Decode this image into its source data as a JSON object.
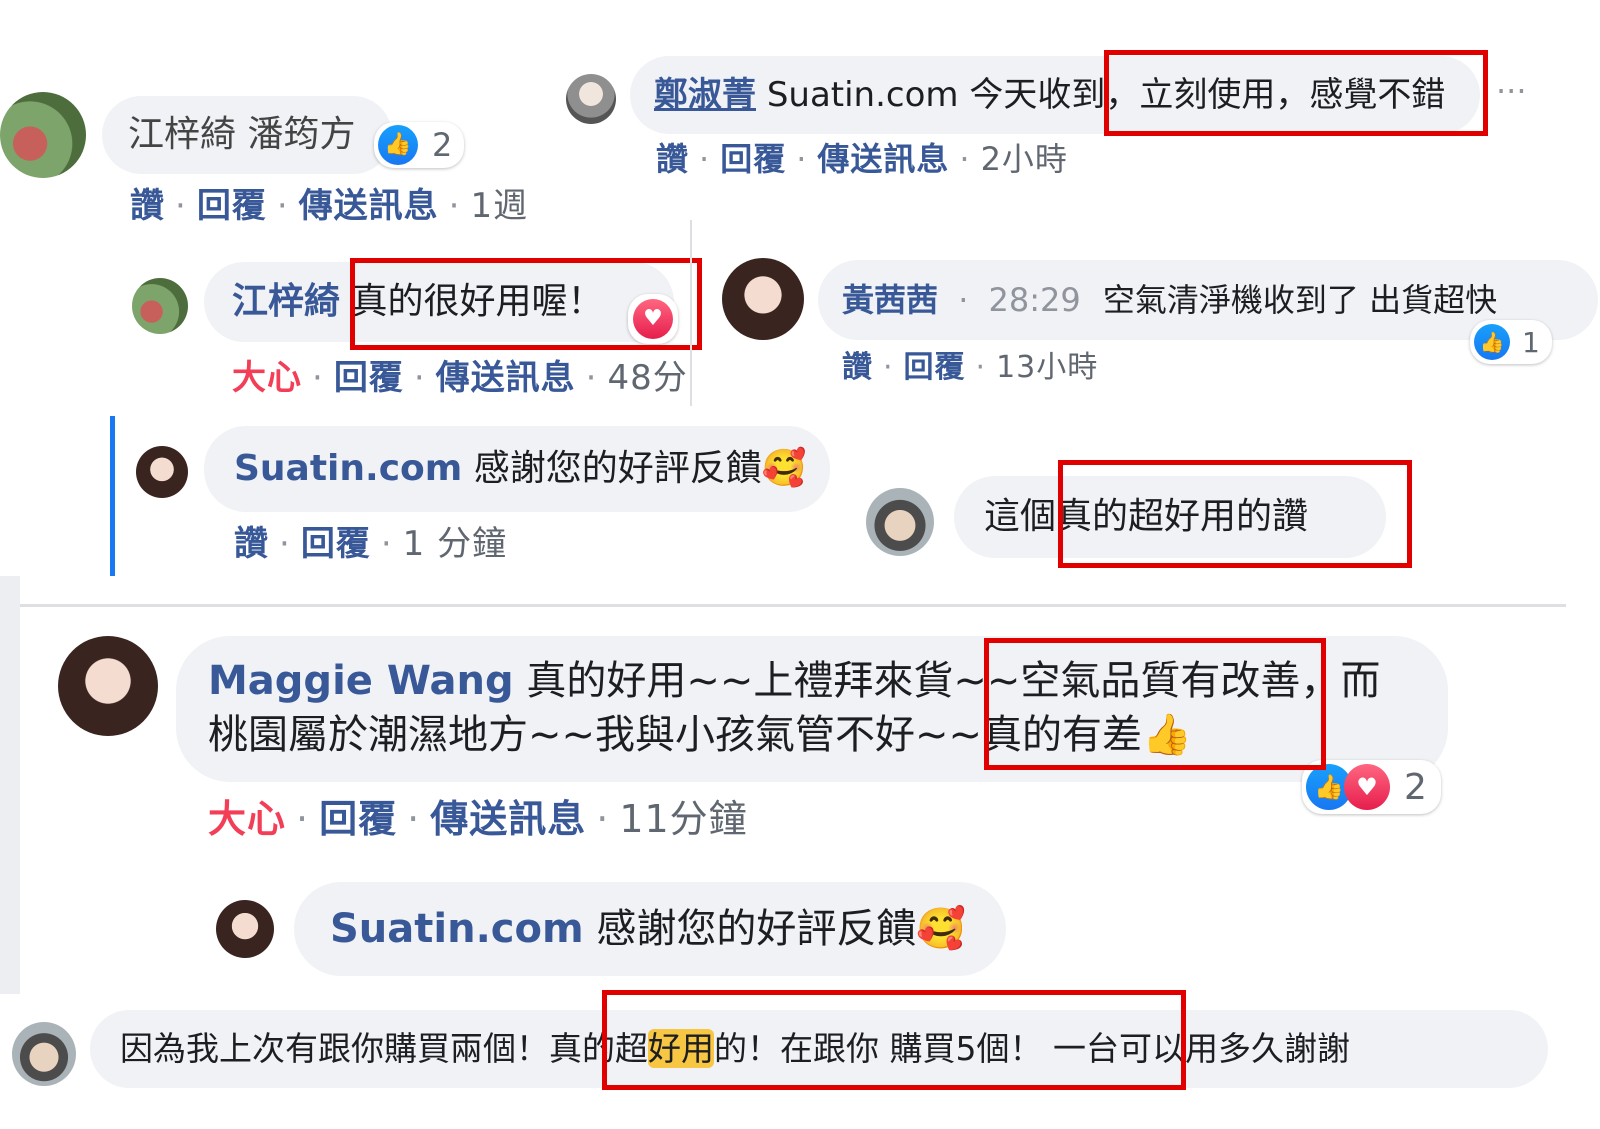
{
  "c1": {
    "names": "江梓綺 潘筠方",
    "likes": "2",
    "actions": [
      "讚",
      "回覆",
      "傳送訊息",
      "1週"
    ]
  },
  "c2": {
    "name": "鄭淑菁",
    "text": "Suatin.com 今天收到，立刻使用，感覺不錯",
    "actions": [
      "讚",
      "回覆",
      "傳送訊息",
      "2小時"
    ],
    "more": "···"
  },
  "c3": {
    "name": "江梓綺",
    "text": "真的很好用喔！",
    "actions": [
      "大心",
      "回覆",
      "傳送訊息",
      "48分"
    ]
  },
  "c4": {
    "name": "黃茜茜",
    "time": "28:29",
    "text": "空氣清淨機收到了 出貨超快",
    "likes": "1",
    "actions": [
      "讚",
      "回覆",
      "13小時"
    ]
  },
  "c5": {
    "name": "Suatin.com",
    "text": "感謝您的好評反饋🥰",
    "actions": [
      "讚",
      "回覆",
      "1 分鐘"
    ]
  },
  "c6": {
    "text": "這個真的超好用的讚"
  },
  "c7": {
    "name": "Maggie Wang",
    "line1": "真的好用~~上禮拜來貨~~空氣品質有改善，而",
    "line2": "桃園屬於潮濕地方~~我與小孩氣管不好~~真的有差👍",
    "reactions": "2",
    "actions": [
      "大心",
      "回覆",
      "傳送訊息",
      "11分鐘"
    ]
  },
  "c8": {
    "name": "Suatin.com",
    "text": "感謝您的好評反饋🥰"
  },
  "c9": {
    "pre": "因為我上次有跟你購買兩個！真的超",
    "highlight": "好用",
    "post": "的！在跟你 購買5個！ 一台可以用多久謝謝"
  },
  "colors": {
    "name_blue": "#385898",
    "bubble_gray": "#f0f2f5",
    "highlight_box": "#e00000",
    "love_red": "#f33e58",
    "like_blue": "#1877f2",
    "search_highlight": "#f7c744"
  }
}
